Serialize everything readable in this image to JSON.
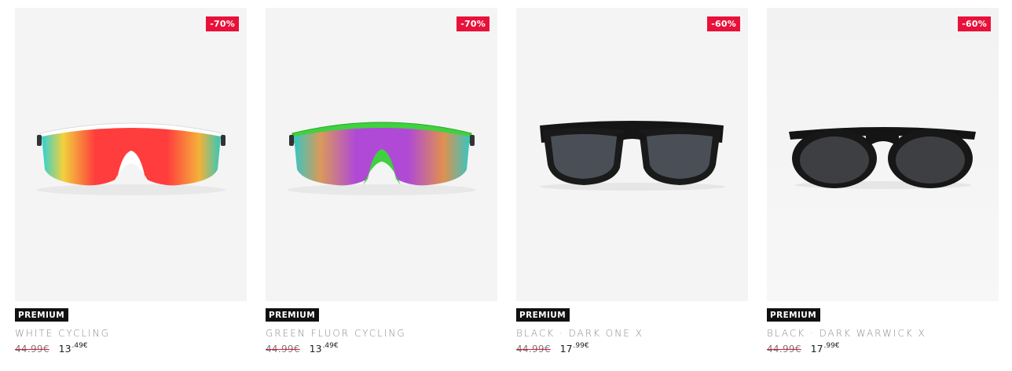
{
  "products": [
    {
      "badge": "-70%",
      "tag": "PREMIUM",
      "name": "WHITE CYCLING",
      "old_price": "44.99€",
      "price_int": "13",
      "price_dec": ".49€",
      "icon": "white-cycling-sunglasses-image"
    },
    {
      "badge": "-70%",
      "tag": "PREMIUM",
      "name": "GREEN FLUOR CYCLING",
      "old_price": "44.99€",
      "price_int": "13",
      "price_dec": ".49€",
      "icon": "green-fluor-cycling-sunglasses-image"
    },
    {
      "badge": "-60%",
      "tag": "PREMIUM",
      "name": "BLACK · DARK ONE X",
      "old_price": "44.99€",
      "price_int": "17",
      "price_dec": ".99€",
      "icon": "black-dark-one-x-sunglasses-image"
    },
    {
      "badge": "-60%",
      "tag": "PREMIUM",
      "name": "BLACK · DARK WARWICK X",
      "old_price": "44.99€",
      "price_int": "17",
      "price_dec": ".99€",
      "icon": "black-dark-warwick-x-sunglasses-image"
    }
  ],
  "colors": {
    "badge": "#e8113a",
    "tag": "#111111",
    "image_bg": "#f4f4f4"
  }
}
